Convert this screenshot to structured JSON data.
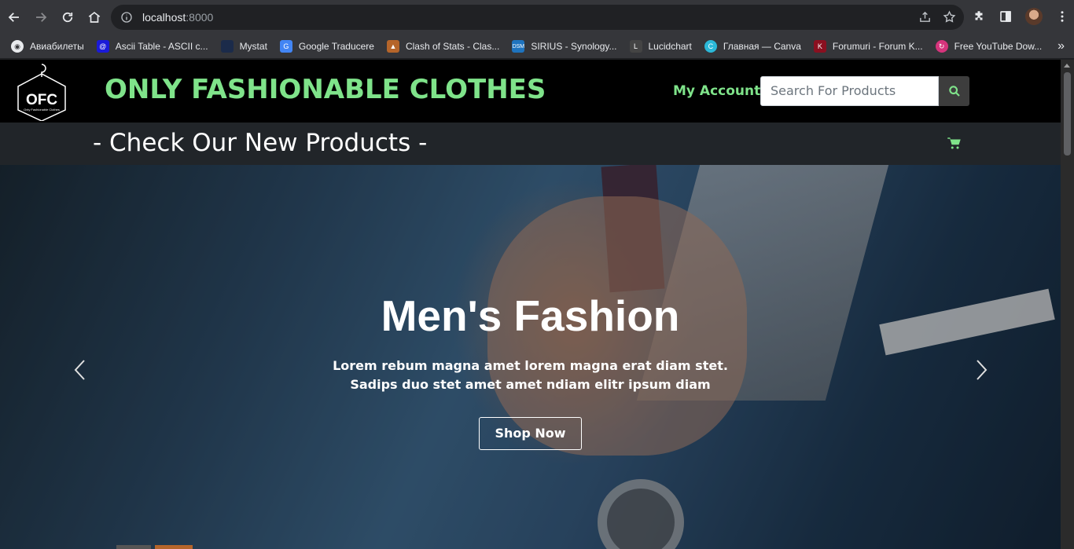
{
  "browser": {
    "url_host": "localhost",
    "url_port": ":8000",
    "bookmarks": [
      {
        "label": "Авиабилеты",
        "icon": "globe-icon",
        "color": "#2b2c2f"
      },
      {
        "label": "Ascii Table - ASCII c...",
        "icon": "ascii-icon",
        "color": "#1a1ad8"
      },
      {
        "label": "Mystat",
        "icon": "mystat-icon",
        "color": "#1b2b4a"
      },
      {
        "label": "Google Traducere",
        "icon": "google-translate-icon",
        "color": "#4285f4"
      },
      {
        "label": "Clash of Stats - Clas...",
        "icon": "clash-icon",
        "color": "#b5652a"
      },
      {
        "label": "SIRIUS - Synology...",
        "icon": "synology-icon",
        "color": "#1e73be"
      },
      {
        "label": "Lucidchart",
        "icon": "lucidchart-icon",
        "color": "#444"
      },
      {
        "label": "Главная — Canva",
        "icon": "canva-icon",
        "color": "#2bb8d8"
      },
      {
        "label": "Forumuri - Forum K...",
        "icon": "forum-icon",
        "color": "#8a1020"
      },
      {
        "label": "Free YouTube Dow...",
        "icon": "youtube-download-icon",
        "color": "#d6347c"
      }
    ]
  },
  "site": {
    "logo_text": "OFC",
    "logo_subtext": "Only Fashionable Clothes",
    "title": "ONLY FASHIONABLE CLOTHES",
    "my_account": "My Account",
    "search_placeholder": "Search For Products",
    "subnav_text": "- Check Our New Products -",
    "accent_color": "#7fe38a"
  },
  "hero": {
    "title": "Men's Fashion",
    "text": "Lorem rebum magna amet lorem magna erat diam stet. Sadips duo stet amet amet ndiam elitr ipsum diam",
    "button": "Shop Now"
  }
}
